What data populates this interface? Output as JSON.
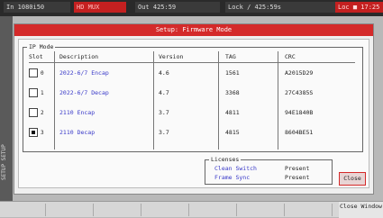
{
  "status_bar": {
    "input": "In 1080i50",
    "middle": "HD MUX",
    "output": "Out 425:59",
    "lock": "Lock / 425:59s",
    "right": "Loc ■ 17:25"
  },
  "side_label": "SETUP SETUP",
  "dialog": {
    "title": "Setup: Firmware Mode",
    "ip_mode": {
      "legend": "IP Mode",
      "headers": {
        "slot": "Slot",
        "description": "Description",
        "version": "Version",
        "tag": "TAG",
        "crc": "CRC"
      },
      "rows": [
        {
          "slot": "0",
          "checked": false,
          "description": "2022-6/7 Encap",
          "version": "4.6",
          "tag": "1561",
          "crc": "A2015D29"
        },
        {
          "slot": "1",
          "checked": false,
          "description": "2022-6/7 Decap",
          "version": "4.7",
          "tag": "3368",
          "crc": "27C4385S"
        },
        {
          "slot": "2",
          "checked": false,
          "description": "2110 Encap",
          "version": "3.7",
          "tag": "4811",
          "crc": "94E1840B"
        },
        {
          "slot": "3",
          "checked": true,
          "description": "2110 Decap",
          "version": "3.7",
          "tag": "4815",
          "crc": "8604BE51"
        }
      ]
    },
    "licenses": {
      "legend": "Licenses",
      "items": [
        {
          "name": "Clean Switch",
          "value": "Present"
        },
        {
          "name": "Frame Sync",
          "value": "Present"
        }
      ]
    },
    "close_label": "Close"
  },
  "bottom_bar": {
    "close_window_label": "Close Window"
  },
  "colors": {
    "accent": "#d42a2a",
    "link_blue": "#3838c8"
  }
}
